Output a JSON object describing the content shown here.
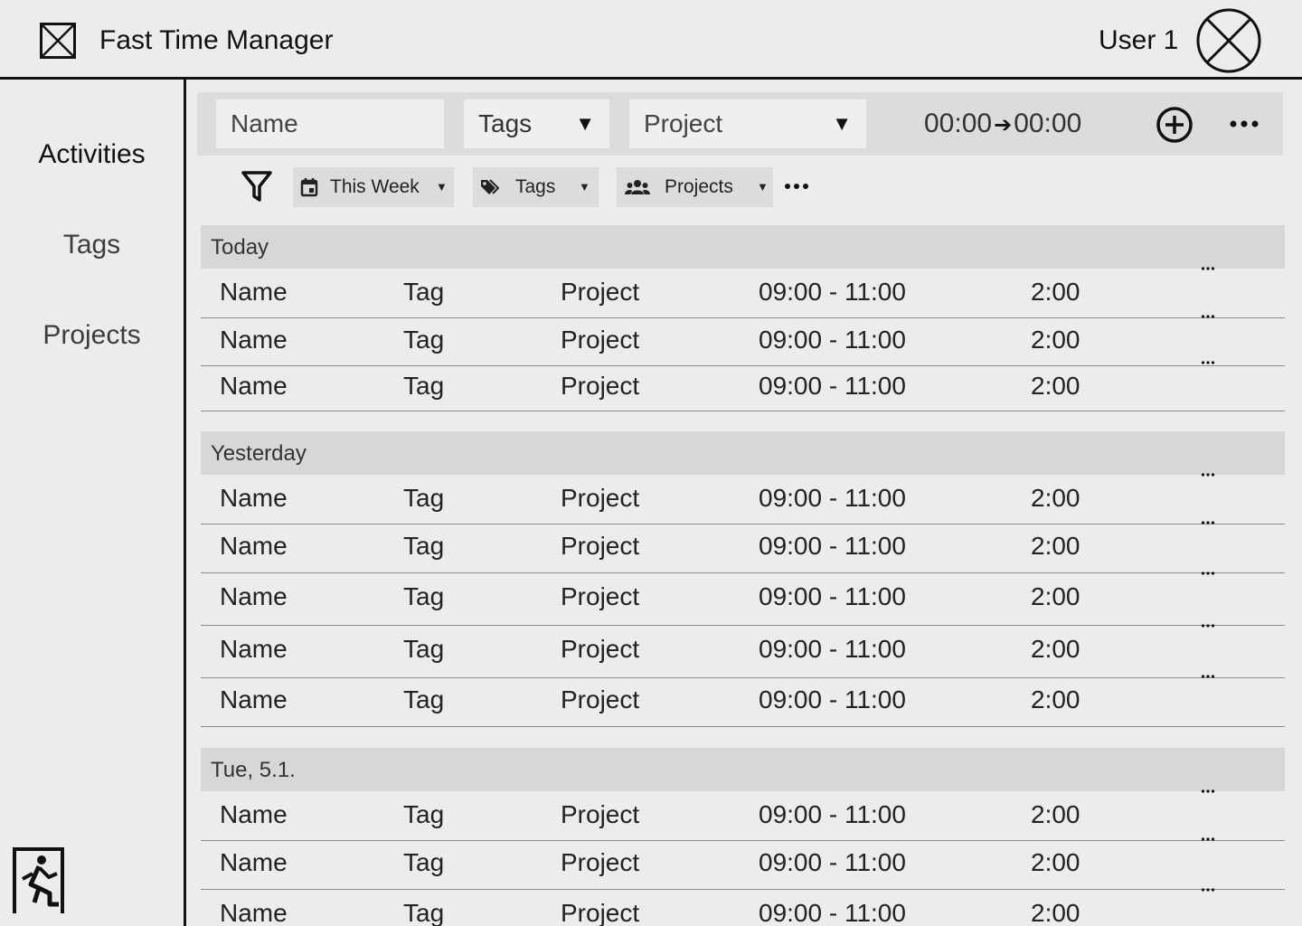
{
  "header": {
    "title": "Fast Time Manager",
    "user": "User 1",
    "logo_icon": "image-placeholder-icon",
    "avatar_icon": "avatar-placeholder-icon"
  },
  "sidebar": {
    "items": [
      {
        "label": "Activities",
        "active": true
      },
      {
        "label": "Tags",
        "active": false
      },
      {
        "label": "Projects",
        "active": false
      }
    ],
    "exit_icon": "exit-icon"
  },
  "entry": {
    "name_placeholder": "Name",
    "tags_label": "Tags",
    "project_label": "Project",
    "caret": "▼",
    "start_time": "00:00",
    "arrow": "➔",
    "end_time": "00:00",
    "add_icon": "plus-circle-icon",
    "more_icon": "more-icon"
  },
  "filters": {
    "filter_icon": "filter-icon",
    "chips": [
      {
        "label": "This Week",
        "icon": "calendar-icon"
      },
      {
        "label": "Tags",
        "icon": "tags-icon"
      },
      {
        "label": "Projects",
        "icon": "people-icon"
      }
    ],
    "caret": "▼",
    "more_icon": "more-icon"
  },
  "groups": [
    {
      "title": "Today",
      "rows": [
        {
          "name": "Name",
          "tag": "Tag",
          "project": "Project",
          "time": "09:00 - 11:00",
          "duration": "2:00"
        },
        {
          "name": "Name",
          "tag": "Tag",
          "project": "Project",
          "time": "09:00 - 11:00",
          "duration": "2:00"
        },
        {
          "name": "Name",
          "tag": "Tag",
          "project": "Project",
          "time": "09:00 - 11:00",
          "duration": "2:00"
        }
      ]
    },
    {
      "title": "Yesterday",
      "rows": [
        {
          "name": "Name",
          "tag": "Tag",
          "project": "Project",
          "time": "09:00 - 11:00",
          "duration": "2:00"
        },
        {
          "name": "Name",
          "tag": "Tag",
          "project": "Project",
          "time": "09:00 - 11:00",
          "duration": "2:00"
        },
        {
          "name": "Name",
          "tag": "Tag",
          "project": "Project",
          "time": "09:00 - 11:00",
          "duration": "2:00"
        },
        {
          "name": "Name",
          "tag": "Tag",
          "project": "Project",
          "time": "09:00 - 11:00",
          "duration": "2:00"
        },
        {
          "name": "Name",
          "tag": "Tag",
          "project": "Project",
          "time": "09:00 - 11:00",
          "duration": "2:00"
        }
      ]
    },
    {
      "title": "Tue, 5.1.",
      "rows": [
        {
          "name": "Name",
          "tag": "Tag",
          "project": "Project",
          "time": "09:00 - 11:00",
          "duration": "2:00"
        },
        {
          "name": "Name",
          "tag": "Tag",
          "project": "Project",
          "time": "09:00 - 11:00",
          "duration": "2:00"
        },
        {
          "name": "Name",
          "tag": "Tag",
          "project": "Project",
          "time": "09:00 - 11:00",
          "duration": "2:00"
        }
      ]
    }
  ]
}
